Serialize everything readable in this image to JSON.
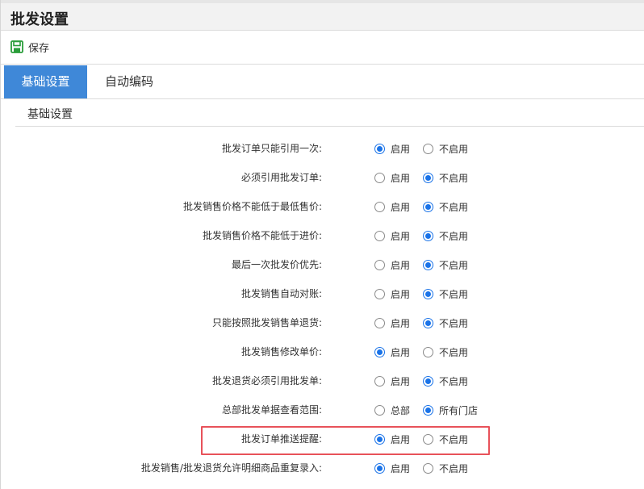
{
  "header": {
    "title": "批发设置"
  },
  "toolbar": {
    "save_label": "保存",
    "save_icon": "save-icon",
    "accent": "#2a9d3a"
  },
  "tabs": [
    {
      "label": "基础设置",
      "active": true
    },
    {
      "label": "自动编码",
      "active": false
    }
  ],
  "section": {
    "title": "基础设置"
  },
  "accent_color": "#3f88d8",
  "highlight_color": "#e8525a",
  "settings": [
    {
      "label": "批发订单只能引用一次:",
      "options": [
        "启用",
        "不启用"
      ],
      "selected": 0
    },
    {
      "label": "必须引用批发订单:",
      "options": [
        "启用",
        "不启用"
      ],
      "selected": 1
    },
    {
      "label": "批发销售价格不能低于最低售价:",
      "options": [
        "启用",
        "不启用"
      ],
      "selected": 1
    },
    {
      "label": "批发销售价格不能低于进价:",
      "options": [
        "启用",
        "不启用"
      ],
      "selected": 1
    },
    {
      "label": "最后一次批发价优先:",
      "options": [
        "启用",
        "不启用"
      ],
      "selected": 1
    },
    {
      "label": "批发销售自动对账:",
      "options": [
        "启用",
        "不启用"
      ],
      "selected": 1
    },
    {
      "label": "只能按照批发销售单退货:",
      "options": [
        "启用",
        "不启用"
      ],
      "selected": 1
    },
    {
      "label": "批发销售修改单价:",
      "options": [
        "启用",
        "不启用"
      ],
      "selected": 0
    },
    {
      "label": "批发退货必须引用批发单:",
      "options": [
        "启用",
        "不启用"
      ],
      "selected": 1
    },
    {
      "label": "总部批发单据查看范围:",
      "options": [
        "总部",
        "所有门店"
      ],
      "selected": 1
    },
    {
      "label": "批发订单推送提醒:",
      "options": [
        "启用",
        "不启用"
      ],
      "selected": 0
    },
    {
      "label": "批发销售/批发退货允许明细商品重复录入:",
      "options": [
        "启用",
        "不启用"
      ],
      "selected": 0
    }
  ]
}
